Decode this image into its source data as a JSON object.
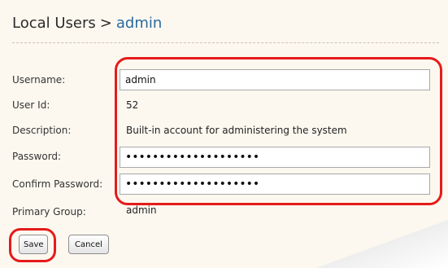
{
  "breadcrumb": {
    "parent": "Local Users",
    "separator": ">",
    "current": "admin"
  },
  "form": {
    "username": {
      "label": "Username:",
      "value": "admin"
    },
    "user_id": {
      "label": "User Id:",
      "value": "52"
    },
    "description": {
      "label": "Description:",
      "value": "Built-in account for administering the system"
    },
    "password": {
      "label": "Password:",
      "value": "••••••••••••••••••••"
    },
    "confirm_password": {
      "label": "Confirm Password:",
      "value": "••••••••••••••••••••"
    },
    "primary_group": {
      "label": "Primary Group:",
      "value": "admin"
    }
  },
  "buttons": {
    "save": "Save",
    "cancel": "Cancel"
  },
  "colors": {
    "panel_background": "#fcf8ef",
    "link": "#2a6aa0",
    "annotation": "#e51b1b"
  }
}
